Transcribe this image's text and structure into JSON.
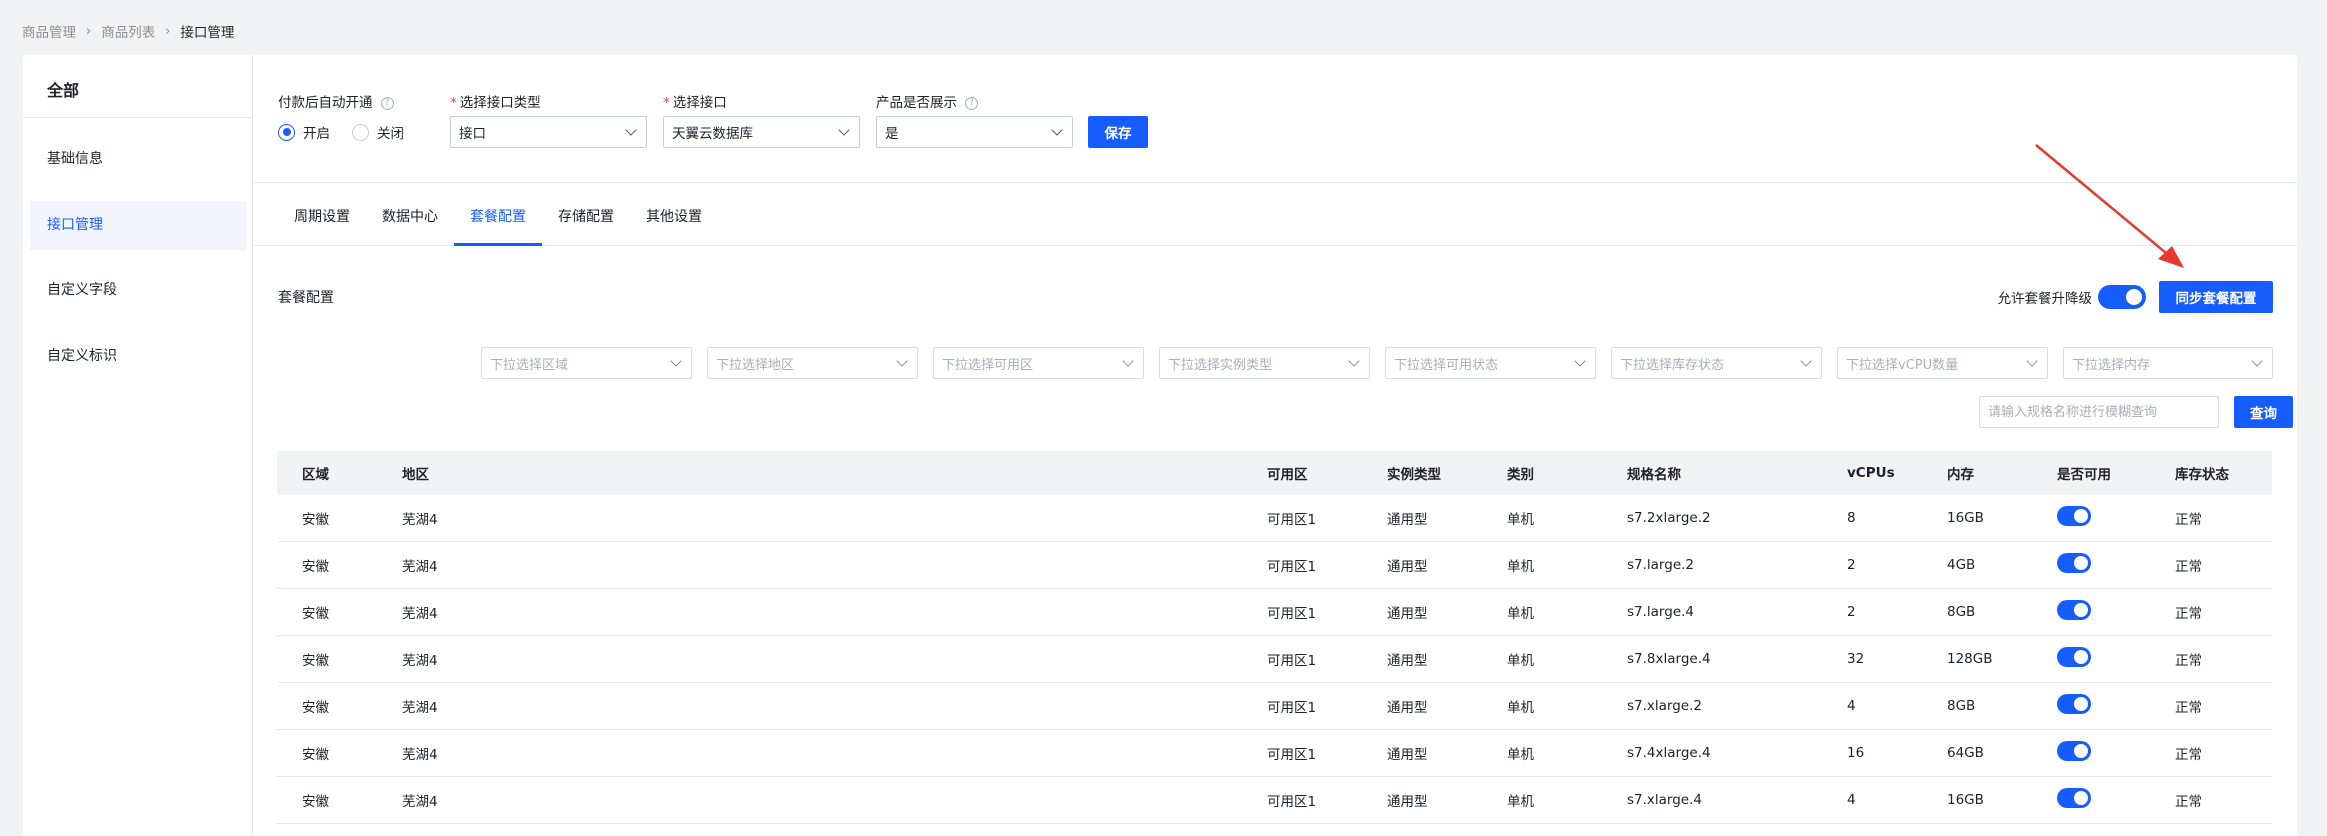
{
  "breadcrumb": [
    "商品管理",
    "商品列表",
    "接口管理"
  ],
  "breadcrumb_sep": "›",
  "sidebar": {
    "all": "全部",
    "items": [
      {
        "label": "基础信息",
        "active": false
      },
      {
        "label": "接口管理",
        "active": true
      },
      {
        "label": "自定义字段",
        "active": false
      },
      {
        "label": "自定义标识",
        "active": false
      }
    ]
  },
  "form": {
    "auto_open_label": "付款后自动开通",
    "radio_on": "开启",
    "radio_off": "关闭",
    "interface_type_label": "选择接口类型",
    "interface_type_value": "接口",
    "interface_label": "选择接口",
    "interface_value": "天翼云数据库",
    "display_label": "产品是否展示",
    "display_value": "是",
    "save": "保存",
    "help_glyph": "?",
    "required_mark": "*"
  },
  "tabs": [
    "周期设置",
    "数据中心",
    "套餐配置",
    "存储配置",
    "其他设置"
  ],
  "active_tab": 2,
  "package": {
    "title": "套餐配置",
    "allow_upgrade_label": "允许套餐升降级",
    "sync_button": "同步套餐配置"
  },
  "filters": [
    "下拉选择区域",
    "下拉选择地区",
    "下拉选择可用区",
    "下拉选择实例类型",
    "下拉选择可用状态",
    "下拉选择库存状态",
    "下拉选择vCPU数量",
    "下拉选择内存"
  ],
  "search": {
    "placeholder": "请输入规格名称进行模糊查询",
    "button": "查询"
  },
  "table": {
    "headers": [
      "区域",
      "地区",
      "可用区",
      "实例类型",
      "类别",
      "规格名称",
      "vCPUs",
      "内存",
      "是否可用",
      "库存状态"
    ],
    "rows": [
      [
        "安徽",
        "芜湖4",
        "可用区1",
        "通用型",
        "单机",
        "s7.2xlarge.2",
        "8",
        "16GB",
        true,
        "正常"
      ],
      [
        "安徽",
        "芜湖4",
        "可用区1",
        "通用型",
        "单机",
        "s7.large.2",
        "2",
        "4GB",
        true,
        "正常"
      ],
      [
        "安徽",
        "芜湖4",
        "可用区1",
        "通用型",
        "单机",
        "s7.large.4",
        "2",
        "8GB",
        true,
        "正常"
      ],
      [
        "安徽",
        "芜湖4",
        "可用区1",
        "通用型",
        "单机",
        "s7.8xlarge.4",
        "32",
        "128GB",
        true,
        "正常"
      ],
      [
        "安徽",
        "芜湖4",
        "可用区1",
        "通用型",
        "单机",
        "s7.xlarge.2",
        "4",
        "8GB",
        true,
        "正常"
      ],
      [
        "安徽",
        "芜湖4",
        "可用区1",
        "通用型",
        "单机",
        "s7.4xlarge.4",
        "16",
        "64GB",
        true,
        "正常"
      ],
      [
        "安徽",
        "芜湖4",
        "可用区1",
        "通用型",
        "单机",
        "s7.xlarge.4",
        "4",
        "16GB",
        true,
        "正常"
      ]
    ]
  },
  "colors": {
    "primary": "#165dff",
    "annotation_arrow": "#e8382f"
  }
}
